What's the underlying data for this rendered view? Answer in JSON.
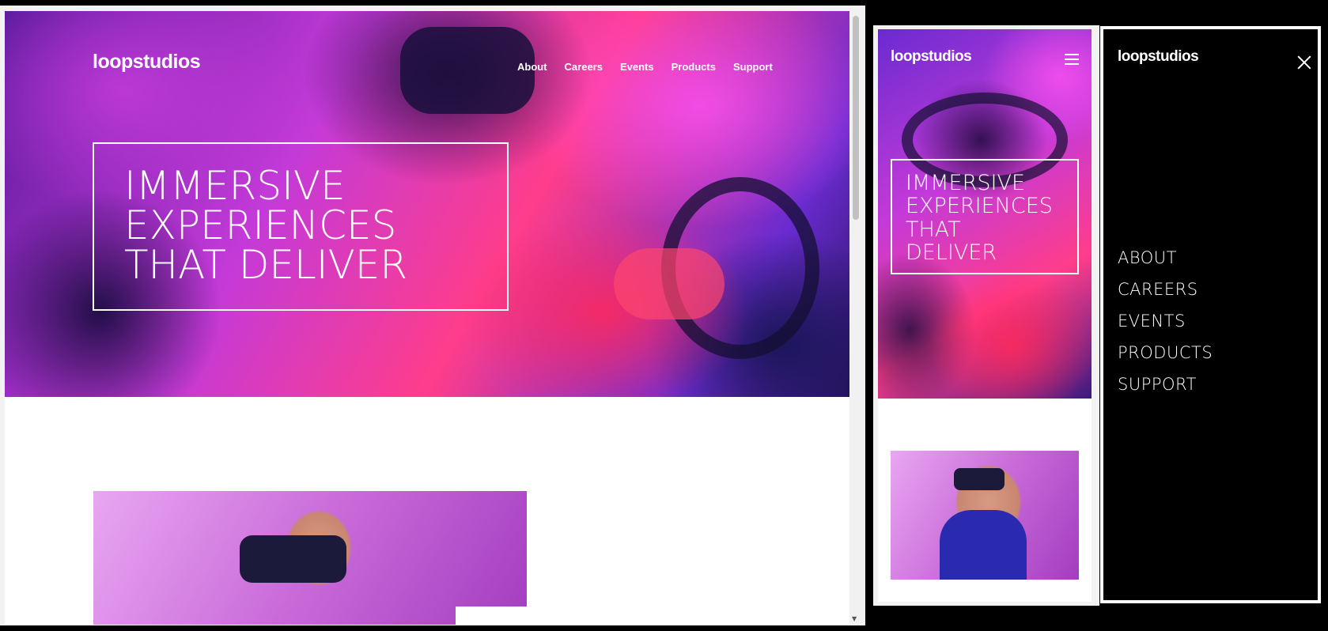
{
  "brand": {
    "logo": "loopstudios"
  },
  "desktop": {
    "nav": [
      "About",
      "Careers",
      "Events",
      "Products",
      "Support"
    ],
    "headline_lines": [
      "IMMERSIVE",
      "EXPERIENCES",
      "THAT DELIVER"
    ]
  },
  "mobile": {
    "headline_lines": [
      "IMMERSIVE",
      "EXPERIENCES",
      "THAT",
      "DELIVER"
    ],
    "menu_icon": "hamburger-icon"
  },
  "menu": {
    "close_icon": "close-icon",
    "items": [
      "ABOUT",
      "CAREERS",
      "EVENTS",
      "PRODUCTS",
      "SUPPORT"
    ]
  },
  "colors": {
    "text_on_dark": "#ffffff",
    "menu_background": "#000000",
    "page_background": "#ffffff"
  }
}
